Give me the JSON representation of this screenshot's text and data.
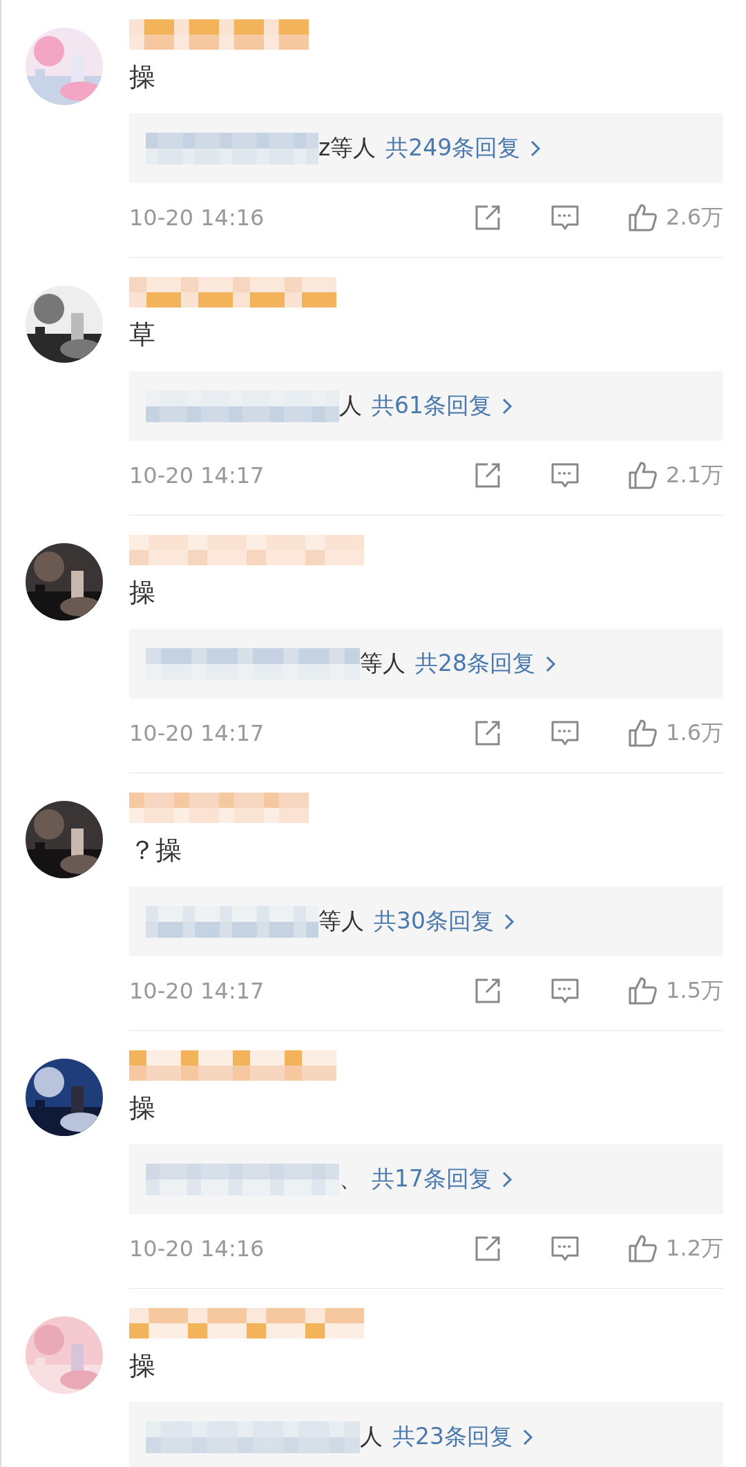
{
  "comments": [
    {
      "text": "操",
      "reply_fragment": "z等人",
      "reply_count": "共249条回复",
      "time": "10-20 14:16",
      "likes": "2.6万"
    },
    {
      "text": "草",
      "reply_fragment": "人",
      "reply_count": "共61条回复",
      "time": "10-20 14:17",
      "likes": "2.1万"
    },
    {
      "text": "操",
      "reply_fragment": "等人",
      "reply_count": "共28条回复",
      "time": "10-20 14:17",
      "likes": "1.6万"
    },
    {
      "text": "？操",
      "reply_fragment": "等人",
      "reply_count": "共30条回复",
      "time": "10-20 14:17",
      "likes": "1.5万"
    },
    {
      "text": "操",
      "reply_fragment": "、",
      "reply_count": "共17条回复",
      "time": "10-20 14:16",
      "likes": "1.2万"
    },
    {
      "text": "操",
      "reply_fragment": "人",
      "reply_count": "共23条回复"
    }
  ]
}
